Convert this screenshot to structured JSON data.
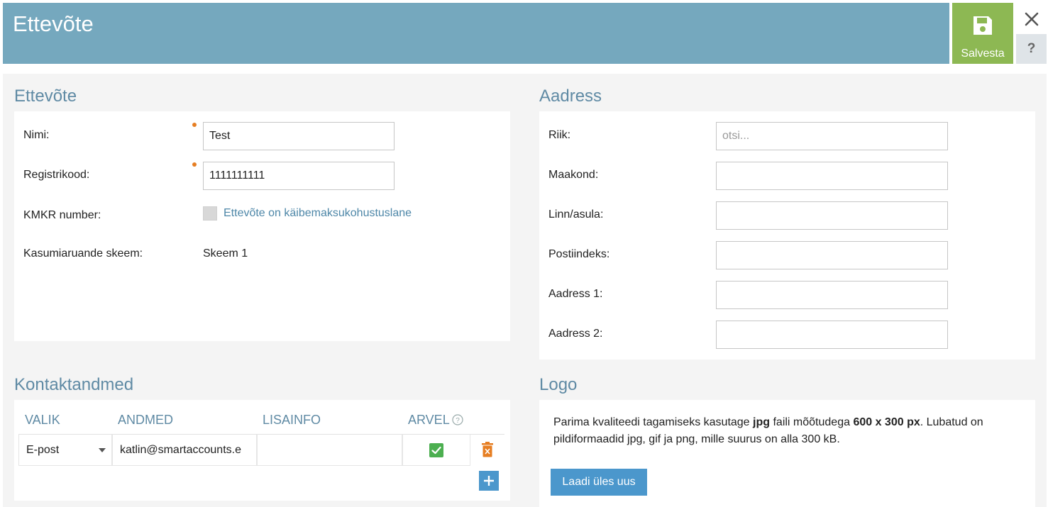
{
  "header": {
    "title": "Ettevõte",
    "save_label": "Salvesta",
    "help_label": "?"
  },
  "company": {
    "section_title": "Ettevõte",
    "name_label": "Nimi:",
    "name_value": "Test",
    "regcode_label": "Registrikood:",
    "regcode_value": "1111111111",
    "vat_label": "KMKR number:",
    "vat_checkbox_label": "Ettevõte on käibemaksukohustuslane",
    "vat_checked": false,
    "scheme_label": "Kasumiaruande skeem:",
    "scheme_value": "Skeem 1"
  },
  "address": {
    "section_title": "Aadress",
    "country_label": "Riik:",
    "country_placeholder": "otsi...",
    "county_label": "Maakond:",
    "city_label": "Linn/asula:",
    "postal_label": "Postiindeks:",
    "address1_label": "Aadress 1:",
    "address2_label": "Aadress 2:"
  },
  "contacts": {
    "section_title": "Kontaktandmed",
    "columns": {
      "choice": "VALIK",
      "data": "ANDMED",
      "extra": "LISAINFO",
      "invoice": "ARVEL"
    },
    "rows": [
      {
        "type": "E-post",
        "data": "katlin@smartaccounts.e",
        "extra": "",
        "invoice": true
      }
    ]
  },
  "logo": {
    "section_title": "Logo",
    "text_before_jpg": "Parima kvaliteedi tagamiseks kasutage ",
    "jpg": "jpg",
    "text_mid": " faili mõõtudega ",
    "size": "600 x 300 px",
    "text_after": ". Lubatud on pildiformaadid jpg, gif ja png, mille suurus on alla 300 kB.",
    "upload_label": "Laadi üles uus"
  },
  "colors": {
    "header": "#75a8be",
    "save": "#8db853",
    "accent": "#4b97cc",
    "required": "#e67e22",
    "delete": "#e67e22",
    "check": "#4caf50"
  }
}
